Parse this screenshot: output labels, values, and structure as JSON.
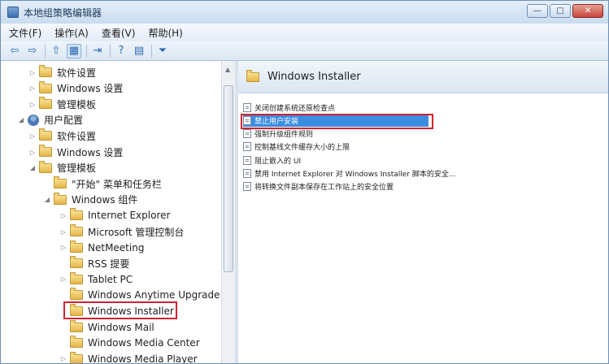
{
  "window": {
    "title": "本地组策略编辑器",
    "minimize": "—",
    "maximize": "□",
    "close": "✕"
  },
  "menu": [
    "文件(F)",
    "操作(A)",
    "查看(V)",
    "帮助(H)"
  ],
  "toolbar": {
    "back": "⇦",
    "forward": "⇨",
    "up": "⇧",
    "show_hide_tree": "▦",
    "export": "⇥",
    "help": "?",
    "properties": "▤",
    "filter": "⏷"
  },
  "tree": {
    "items": [
      {
        "label": "软件设置",
        "level": 2,
        "expander": "▷"
      },
      {
        "label": "Windows 设置",
        "level": 2,
        "expander": "▷"
      },
      {
        "label": "管理模板",
        "level": 2,
        "expander": "▷"
      },
      {
        "label": "用户配置",
        "level": 1,
        "expander": "◢"
      },
      {
        "label": "软件设置",
        "level": 2,
        "expander": "▷"
      },
      {
        "label": "Windows 设置",
        "level": 2,
        "expander": "▷"
      },
      {
        "label": "管理模板",
        "level": 2,
        "expander": "◢"
      },
      {
        "label": "\"开始\" 菜单和任务栏",
        "level": 3,
        "expander": ""
      },
      {
        "label": "Windows 组件",
        "level": 3,
        "expander": "◢"
      },
      {
        "label": "Internet Explorer",
        "level": 4,
        "expander": "▷"
      },
      {
        "label": "Microsoft 管理控制台",
        "level": 4,
        "expander": "▷"
      },
      {
        "label": "NetMeeting",
        "level": 4,
        "expander": "▷"
      },
      {
        "label": "RSS 提要",
        "level": 4,
        "expander": ""
      },
      {
        "label": "Tablet PC",
        "level": 4,
        "expander": "▷"
      },
      {
        "label": "Windows Anytime Upgrade",
        "level": 4,
        "expander": ""
      },
      {
        "label": "Windows Installer",
        "level": 4,
        "expander": "",
        "highlighted": true
      },
      {
        "label": "Windows Mail",
        "level": 4,
        "expander": ""
      },
      {
        "label": "Windows Media Center",
        "level": 4,
        "expander": ""
      },
      {
        "label": "Windows Media Player",
        "level": 4,
        "expander": "▷"
      }
    ]
  },
  "right_panel": {
    "header": "Windows Installer",
    "policies": [
      {
        "label": "关闭创建系统还原检查点"
      },
      {
        "label": "禁止用户安装",
        "selected": true
      },
      {
        "label": "强制升级组件规则"
      },
      {
        "label": "控制基线文件缓存大小的上限"
      },
      {
        "label": "阻止嵌入的 UI"
      },
      {
        "label": "禁用 Internet Explorer 对 Windows Installer 脚本的安全..."
      },
      {
        "label": "将转换文件副本保存在工作站上的安全位置"
      }
    ]
  },
  "colors": {
    "highlight_outline": "#d22030",
    "selection": "#3b8de0"
  }
}
